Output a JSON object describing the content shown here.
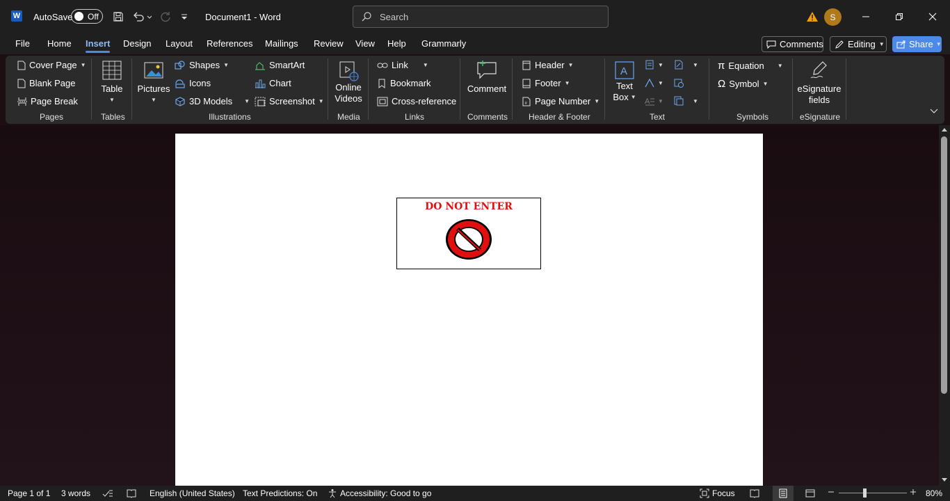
{
  "app": {
    "autosave_label": "AutoSave",
    "autosave_state": "Off",
    "doc_title": "Document1  -  Word",
    "search_placeholder": "Search",
    "avatar_initial": "S",
    "accent": "#4d8ae8"
  },
  "tabs": [
    "File",
    "Home",
    "Insert",
    "Design",
    "Layout",
    "References",
    "Mailings",
    "Review",
    "View",
    "Help",
    "Grammarly"
  ],
  "active_tab": "Insert",
  "header_buttons": {
    "comments": "Comments",
    "editing": "Editing",
    "share": "Share"
  },
  "ribbon": {
    "pages": {
      "cover_page": "Cover Page",
      "blank_page": "Blank Page",
      "page_break": "Page Break",
      "label": "Pages"
    },
    "tables": {
      "table": "Table",
      "label": "Tables"
    },
    "illustrations": {
      "pictures": "Pictures",
      "shapes": "Shapes",
      "icons": "Icons",
      "models": "3D Models",
      "smartart": "SmartArt",
      "chart": "Chart",
      "screenshot": "Screenshot",
      "label": "Illustrations"
    },
    "media": {
      "online_videos_1": "Online",
      "online_videos_2": "Videos",
      "label": "Media"
    },
    "links": {
      "link": "Link",
      "bookmark": "Bookmark",
      "cross_reference": "Cross-reference",
      "label": "Links"
    },
    "comments": {
      "comment": "Comment",
      "label": "Comments"
    },
    "header_footer": {
      "header": "Header",
      "footer": "Footer",
      "page_number": "Page Number",
      "label": "Header & Footer"
    },
    "text": {
      "text_box_1": "Text",
      "text_box_2": "Box",
      "label": "Text"
    },
    "symbols": {
      "equation": "Equation",
      "symbol": "Symbol",
      "label": "Symbols"
    },
    "esignature": {
      "fields_1": "eSignature",
      "fields_2": "fields",
      "label": "eSignature"
    }
  },
  "document": {
    "sign_title": "DO NOT ENTER",
    "sign_color": "#e01010"
  },
  "status": {
    "page": "Page 1 of 1",
    "words": "3 words",
    "language": "English (United States)",
    "predictions": "Text Predictions: On",
    "accessibility": "Accessibility: Good to go",
    "focus": "Focus",
    "zoom": "80%"
  }
}
